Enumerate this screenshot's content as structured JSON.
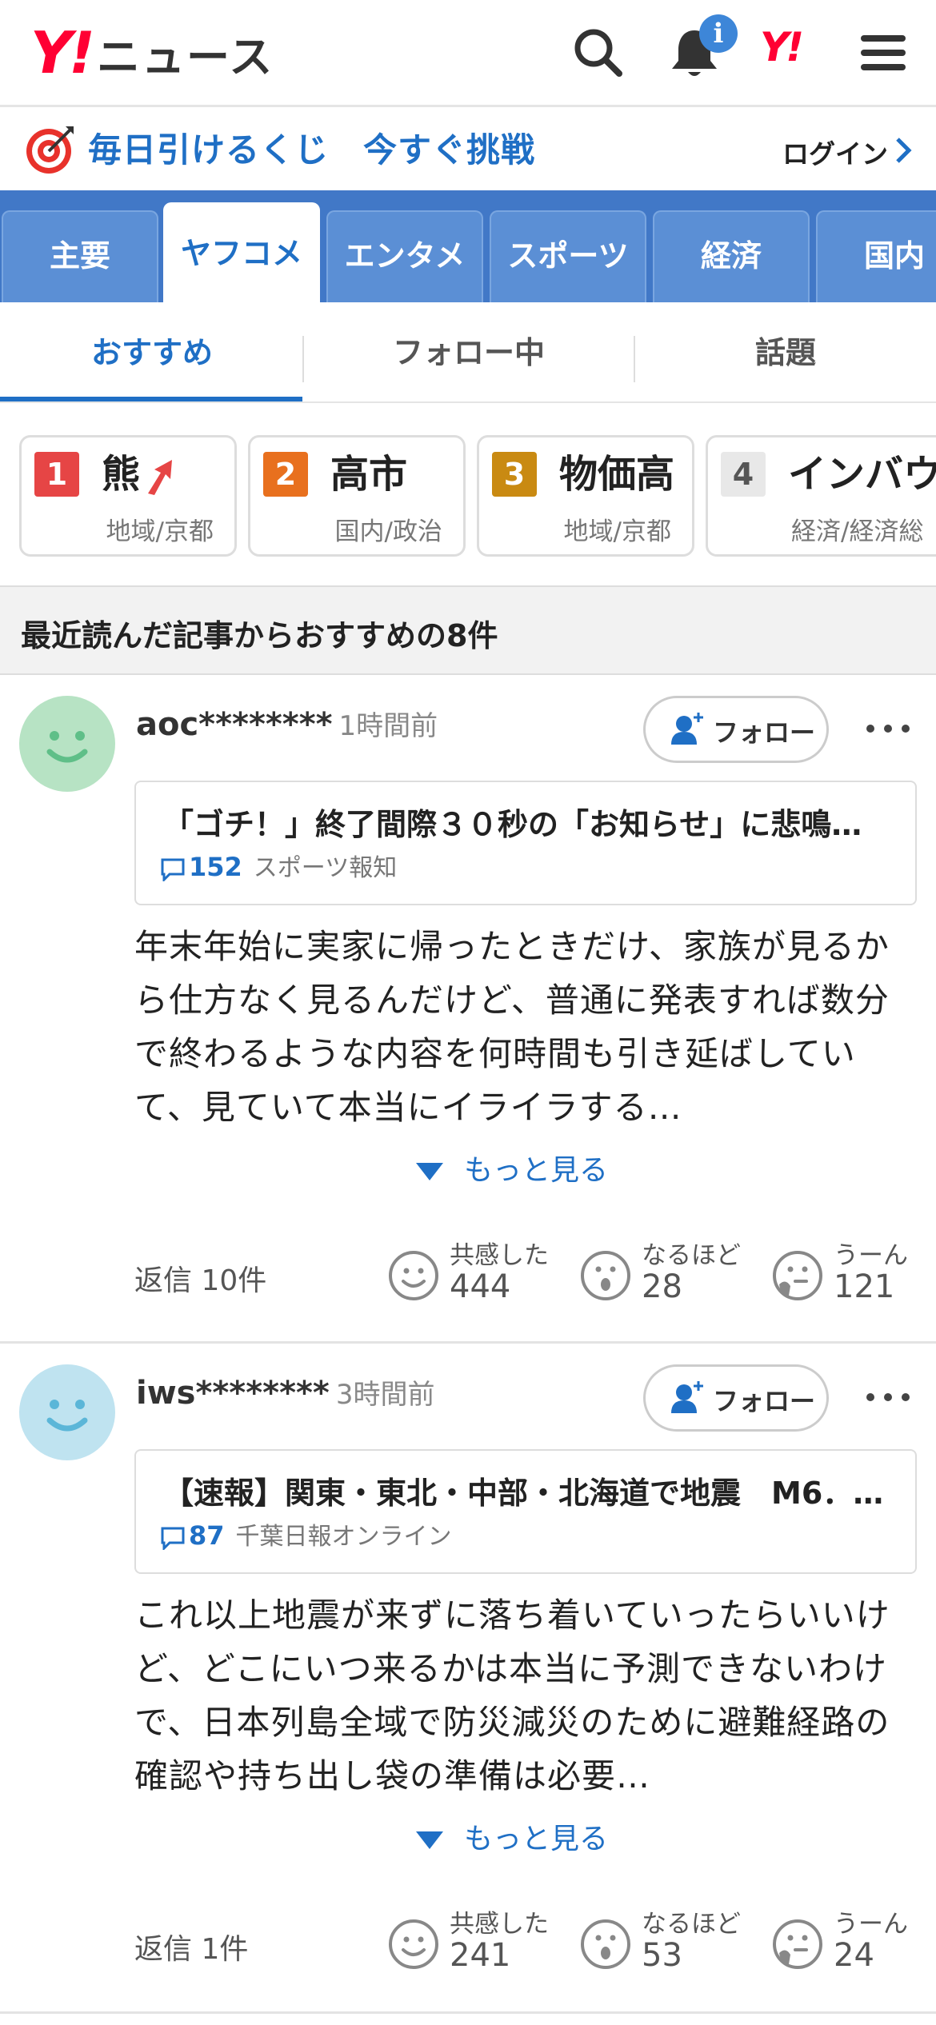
{
  "header": {
    "logo_mark": "Y!",
    "logo_text": "ニュース",
    "notification_badge": "i",
    "yahoo_mark": "Y!"
  },
  "promo": {
    "text": "毎日引けるくじ　今すぐ挑戦",
    "login_label": "ログイン"
  },
  "category_tabs": [
    {
      "label": "主要",
      "active": false
    },
    {
      "label": "ヤフコメ",
      "active": true
    },
    {
      "label": "エンタメ",
      "active": false
    },
    {
      "label": "スポーツ",
      "active": false
    },
    {
      "label": "経済",
      "active": false
    },
    {
      "label": "国内",
      "active": false
    }
  ],
  "sub_tabs": [
    {
      "label": "おすすめ",
      "active": true
    },
    {
      "label": "フォロー中",
      "active": false
    },
    {
      "label": "話題",
      "active": false
    }
  ],
  "trending": [
    {
      "rank": "1",
      "word": "熊",
      "category": "地域/京都",
      "rank_color": "#e64545",
      "rising": true
    },
    {
      "rank": "2",
      "word": "高市",
      "category": "国内/政治",
      "rank_color": "#e8701e"
    },
    {
      "rank": "3",
      "word": "物価高",
      "category": "地域/京都",
      "rank_color": "#c98a12"
    },
    {
      "rank": "4",
      "word": "インバウ",
      "category": "経済/経済総",
      "rank_color": "#e8e8e8"
    }
  ],
  "section_title": "最近読んだ記事からおすすめの8件",
  "comments": [
    {
      "user": "aoc********",
      "time": "1時間前",
      "follow_label": "フォロー",
      "article_title": "「ゴチ！」終了間際３０秒の「お知らせ」に悲鳴…",
      "article_comment_count": "152",
      "article_source": "スポーツ報知",
      "text": "年末年始に実家に帰ったときだけ、家族が見るから仕方なく見るんだけど、普通に発表すれば数分で終わるような内容を何時間も引き延ばしていて、見ていて本当にイライラする…",
      "more_label": "もっと見る",
      "replies": "返信 10件",
      "reactions": [
        {
          "label": "共感した",
          "count": "444",
          "icon": "smile-icon"
        },
        {
          "label": "なるほど",
          "count": "28",
          "icon": "surprised-icon"
        },
        {
          "label": "うーん",
          "count": "121",
          "icon": "thinking-icon"
        }
      ],
      "avatar_color": "#b7e3c4"
    },
    {
      "user": "iws********",
      "time": "3時間前",
      "follow_label": "フォロー",
      "article_title": "【速報】関東・東北・中部・北海道で地震　M6．…",
      "article_comment_count": "87",
      "article_source": "千葉日報オンライン",
      "text": "これ以上地震が来ずに落ち着いていったらいいけど、どこにいつ来るかは本当に予測できないわけで、日本列島全域で防災減災のために避難経路の確認や持ち出し袋の準備は必要…",
      "more_label": "もっと見る",
      "replies": "返信 1件",
      "reactions": [
        {
          "label": "共感した",
          "count": "241",
          "icon": "smile-icon"
        },
        {
          "label": "なるほど",
          "count": "53",
          "icon": "surprised-icon"
        },
        {
          "label": "うーん",
          "count": "24",
          "icon": "thinking-icon"
        }
      ],
      "avatar_color": "#bfe3f0"
    }
  ]
}
